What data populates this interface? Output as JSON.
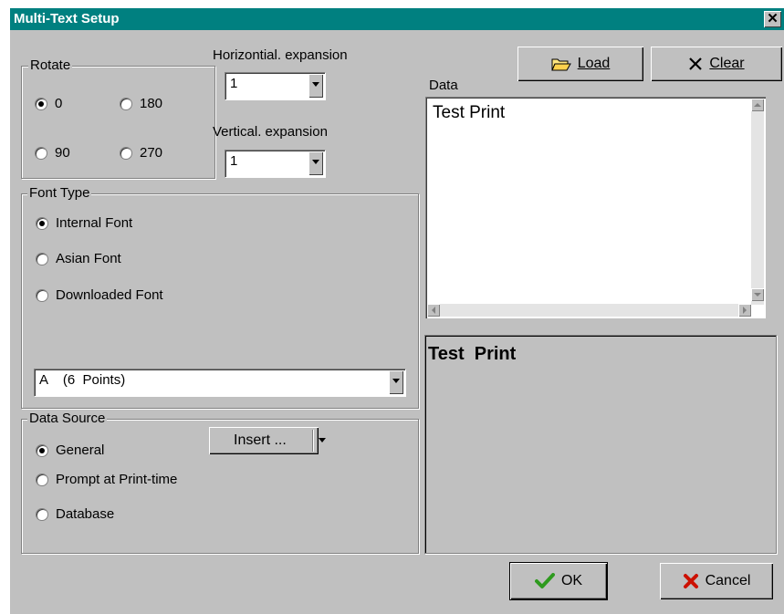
{
  "window": {
    "title": "Multi-Text Setup",
    "close_glyph": "✕"
  },
  "rotate": {
    "legend": "Rotate",
    "options": [
      {
        "label": "0",
        "selected": true
      },
      {
        "label": "180",
        "selected": false
      },
      {
        "label": "90",
        "selected": false
      },
      {
        "label": "270",
        "selected": false
      }
    ]
  },
  "expansion": {
    "horizontal_label": "Horizontial. expansion",
    "horizontal_value": "1",
    "vertical_label": "Vertical. expansion",
    "vertical_value": "1"
  },
  "font_type": {
    "legend": "Font Type",
    "options": [
      {
        "label": "Internal Font",
        "selected": true
      },
      {
        "label": "Asian Font",
        "selected": false
      },
      {
        "label": "Downloaded Font",
        "selected": false
      }
    ],
    "font_select_value": "A    (6  Points)"
  },
  "data_source": {
    "legend": "Data Source",
    "options": [
      {
        "label": "General",
        "selected": true
      },
      {
        "label": "Prompt at Print-time",
        "selected": false
      },
      {
        "label": "Database",
        "selected": false
      }
    ],
    "insert_label": "Insert ..."
  },
  "data": {
    "label": "Data",
    "text": "Test Print",
    "load_label": "Load",
    "clear_label": "Clear"
  },
  "preview": {
    "text": "Test  Print"
  },
  "footer": {
    "ok_label": "OK",
    "cancel_label": "Cancel"
  },
  "colors": {
    "titlebar": "#008080",
    "face": "#c0c0c0",
    "ok_check": "#2e9a1e",
    "cancel_x": "#cc1100"
  }
}
